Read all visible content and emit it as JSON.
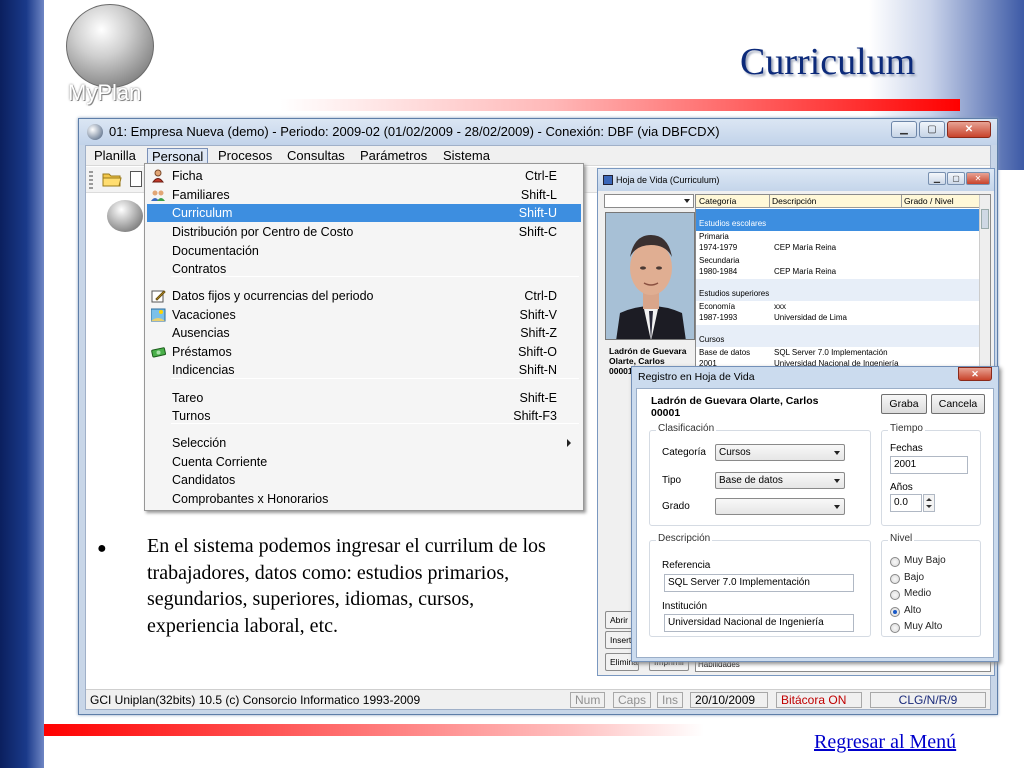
{
  "slide": {
    "title": "Curriculum",
    "logo_text": "MyPlan",
    "bullet": "En el sistema podemos ingresar el currilum de los trabajadores, datos como: estudios primarios, segundarios, superiores, idiomas, cursos, experiencia laboral, etc.",
    "back_link": "Regresar al Menú"
  },
  "window": {
    "title": "01: Empresa Nueva  (demo)  - Periodo: 2009-02 (01/02/2009 - 28/02/2009) - Conexión: DBF (via DBFCDX)",
    "menu": [
      "Planilla",
      "Personal",
      "Procesos",
      "Consultas",
      "Parámetros",
      "Sistema"
    ],
    "active_menu": "Personal",
    "status": {
      "text": "GCI Uniplan(32bits) 10.5  (c) Consorcio Informatico 1993-2009",
      "num": "Num",
      "caps": "Caps",
      "ins": "Ins",
      "date": "20/10/2009",
      "bitacora": "Bitácora ON",
      "codes": "CLG/N/R/9"
    }
  },
  "dropdown": {
    "items": [
      {
        "label": "Ficha",
        "shortcut": "Ctrl-E",
        "icon": "person-icon"
      },
      {
        "label": "Familiares",
        "shortcut": "Shift-L",
        "icon": "family-icon"
      },
      {
        "label": "Curriculum",
        "shortcut": "Shift-U",
        "icon": "",
        "selected": true
      },
      {
        "label": "Distribución por Centro de Costo",
        "shortcut": "Shift-C",
        "icon": ""
      },
      {
        "label": "Documentación",
        "shortcut": "",
        "icon": ""
      },
      {
        "label": "Contratos",
        "shortcut": "",
        "icon": ""
      },
      {
        "label": "Datos fijos y ocurrencias del periodo",
        "shortcut": "Ctrl-D",
        "icon": "edit-icon"
      },
      {
        "label": "Vacaciones",
        "shortcut": "Shift-V",
        "icon": "vacation-icon"
      },
      {
        "label": "Ausencias",
        "shortcut": "Shift-Z",
        "icon": ""
      },
      {
        "label": "Préstamos",
        "shortcut": "Shift-O",
        "icon": "money-icon"
      },
      {
        "label": "Indicencias",
        "shortcut": "Shift-N",
        "icon": ""
      },
      {
        "label": "Tareo",
        "shortcut": "Shift-E",
        "icon": ""
      },
      {
        "label": "Turnos",
        "shortcut": "Shift-F3",
        "icon": ""
      },
      {
        "label": "Selección",
        "shortcut": "",
        "icon": "",
        "submenu": true
      },
      {
        "label": "Cuenta Corriente",
        "shortcut": "",
        "icon": ""
      },
      {
        "label": "Candidatos",
        "shortcut": "",
        "icon": ""
      },
      {
        "label": "Comprobantes x Honorarios",
        "shortcut": "",
        "icon": ""
      }
    ]
  },
  "hoja_de_vida": {
    "title": "Hoja de Vida (Curriculum)",
    "person_name": "Ladrón de Guevara Olarte, Carlos",
    "person_code": "00001",
    "columns": [
      "Categoría",
      "Descripción",
      "Grado / Nivel"
    ],
    "groups": [
      {
        "header": "Estudios escolares",
        "selected": true,
        "rows": []
      },
      {
        "header": "",
        "rows": [
          {
            "cat": "Primaria",
            "years": "1974-1979",
            "desc": "CEP María Reina"
          }
        ]
      },
      {
        "header": "",
        "rows": [
          {
            "cat": "Secundaria",
            "years": "1980-1984",
            "desc": "CEP María Reina"
          }
        ]
      },
      {
        "header": "Estudios superiores",
        "rows": [
          {
            "cat": "Economía",
            "years": "1987-1993",
            "desc": "xxx",
            "desc2": "Universidad de Lima"
          }
        ]
      },
      {
        "header": "Cursos",
        "rows": [
          {
            "cat": "Base de datos",
            "years": "2001",
            "desc": "SQL Server 7.0 Implementación",
            "desc2": "Universidad Nacional de Ingeniería"
          }
        ]
      }
    ],
    "side_buttons": [
      "Abrir",
      "Insertar",
      "Eliminar",
      "Imprimir"
    ],
    "bottom_combo": "Habilidades"
  },
  "dialog": {
    "title": "Registro en Hoja de Vida",
    "person_name": "Ladrón de Guevara Olarte, Carlos",
    "person_code": "00001",
    "save": "Graba",
    "cancel": "Cancela",
    "clasificacion": {
      "label": "Clasificación",
      "categoria_label": "Categoría",
      "categoria": "Cursos",
      "tipo_label": "Tipo",
      "tipo": "Base de datos",
      "grado_label": "Grado",
      "grado": ""
    },
    "tiempo": {
      "label": "Tiempo",
      "fechas_label": "Fechas",
      "fechas": "2001",
      "anios_label": "Años",
      "anios": "0.0"
    },
    "descripcion": {
      "label": "Descripción",
      "referencia_label": "Referencia",
      "referencia": "SQL Server 7.0 Implementación",
      "institucion_label": "Institución",
      "institucion": "Universidad Nacional de Ingeniería"
    },
    "nivel": {
      "label": "Nivel",
      "options": [
        "Muy Bajo",
        "Bajo",
        "Medio",
        "Alto",
        "Muy Alto"
      ],
      "selected": "Alto"
    }
  },
  "colors": {
    "title": "#0c2a7a",
    "menu_selection": "#3d8ee0",
    "accent_red": "#ff0000",
    "link": "#0000cc"
  }
}
